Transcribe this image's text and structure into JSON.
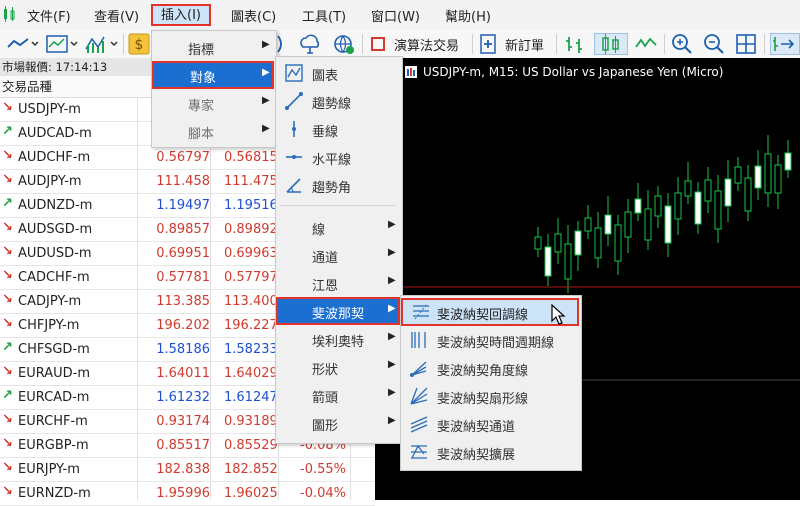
{
  "menubar": {
    "items": [
      "文件(F)",
      "查看(V)",
      "插入(I)",
      "圖表(C)",
      "工具(T)",
      "窗口(W)",
      "幫助(H)"
    ],
    "active": "插入(I)"
  },
  "toolbar": {
    "algo_label": "演算法交易",
    "new_order_label": "新訂單"
  },
  "market_watch": {
    "header": "市場報價: 17:14:13",
    "col_symbol": "交易品種",
    "rows": [
      {
        "dir": "down",
        "sym": "USDJPY-m",
        "bid": "",
        "ask": "",
        "chg": ""
      },
      {
        "dir": "up",
        "sym": "AUDCAD-m",
        "bid": "",
        "ask": "",
        "chg": ""
      },
      {
        "dir": "down",
        "sym": "AUDCHF-m",
        "bid": "0.56797",
        "ask": "0.56815",
        "chg": ""
      },
      {
        "dir": "down",
        "sym": "AUDJPY-m",
        "bid": "111.458",
        "ask": "111.475",
        "chg": ""
      },
      {
        "dir": "up",
        "sym": "AUDNZD-m",
        "bid": "1.19497",
        "ask": "1.19516",
        "chg": ""
      },
      {
        "dir": "down",
        "sym": "AUDSGD-m",
        "bid": "0.89857",
        "ask": "0.89892",
        "chg": ""
      },
      {
        "dir": "down",
        "sym": "AUDUSD-m",
        "bid": "0.69951",
        "ask": "0.69963",
        "chg": ""
      },
      {
        "dir": "down",
        "sym": "CADCHF-m",
        "bid": "0.57781",
        "ask": "0.57797",
        "chg": ""
      },
      {
        "dir": "down",
        "sym": "CADJPY-m",
        "bid": "113.385",
        "ask": "113.400",
        "chg": ""
      },
      {
        "dir": "down",
        "sym": "CHFJPY-m",
        "bid": "196.202",
        "ask": "196.227",
        "chg": ""
      },
      {
        "dir": "up",
        "sym": "CHFSGD-m",
        "bid": "1.58186",
        "ask": "1.58233",
        "chg": ""
      },
      {
        "dir": "down",
        "sym": "EURAUD-m",
        "bid": "1.64011",
        "ask": "1.64029",
        "chg": ""
      },
      {
        "dir": "up",
        "sym": "EURCAD-m",
        "bid": "1.61232",
        "ask": "1.61247",
        "chg": ""
      },
      {
        "dir": "down",
        "sym": "EURCHF-m",
        "bid": "0.93174",
        "ask": "0.93189",
        "chg": ""
      },
      {
        "dir": "down",
        "sym": "EURGBP-m",
        "bid": "0.85517",
        "ask": "0.85529",
        "chg": "-0.08%"
      },
      {
        "dir": "down",
        "sym": "EURJPY-m",
        "bid": "182.838",
        "ask": "182.852",
        "chg": "-0.55%"
      },
      {
        "dir": "down",
        "sym": "EURNZD-m",
        "bid": "1.95996",
        "ask": "1.96025",
        "chg": "-0.04%"
      }
    ]
  },
  "chart": {
    "title": "USDJPY-m, M15:  US Dollar vs Japanese Yen (Micro)"
  },
  "insert_menu": {
    "items": [
      "指標",
      "對象",
      "專家",
      "腳本"
    ],
    "highlighted": "對象"
  },
  "objects_menu": {
    "items": [
      "圖表",
      "趨勢線",
      "垂線",
      "水平線",
      "趨勢角",
      "線",
      "通道",
      "江恩",
      "斐波那契",
      "埃利奧特",
      "形狀",
      "箭頭",
      "圖形"
    ],
    "highlighted": "斐波那契"
  },
  "fib_menu": {
    "items": [
      "斐波納契回調線",
      "斐波納契時間週期線",
      "斐波納契角度線",
      "斐波納契扇形線",
      "斐波納契通道",
      "斐波納契擴展"
    ],
    "highlighted": "斐波納契回調線"
  },
  "colors": {
    "highlight_blue": "#1a6fd0",
    "outline_red": "#e4322b",
    "price_blue": "#1d4fd8",
    "price_red": "#d23a2e",
    "candle_green": "#19c24a"
  }
}
